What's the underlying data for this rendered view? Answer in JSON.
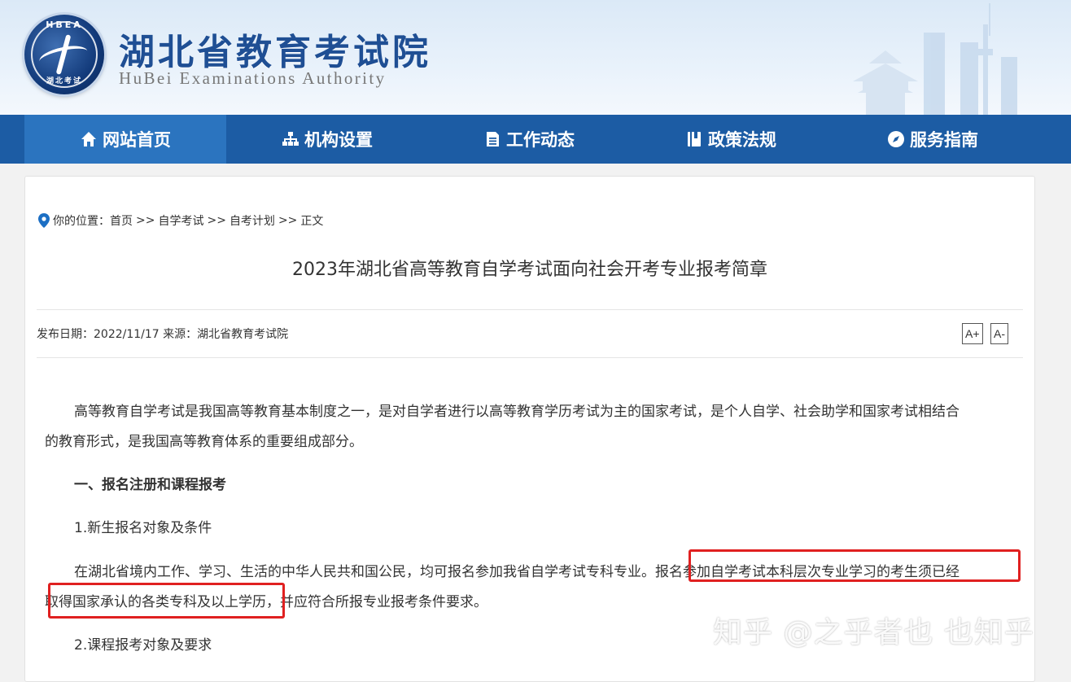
{
  "header": {
    "logo_top_text": "HBEA",
    "logo_bottom_text": "湖北考试",
    "title_cn": "湖北省教育考试院",
    "title_en": "HuBei Examinations Authority"
  },
  "nav": {
    "items": [
      {
        "label": "网站首页",
        "icon": "home-icon"
      },
      {
        "label": "机构设置",
        "icon": "org-chart-icon"
      },
      {
        "label": "工作动态",
        "icon": "document-icon"
      },
      {
        "label": "政策法规",
        "icon": "book-icon"
      },
      {
        "label": "服务指南",
        "icon": "compass-icon"
      }
    ],
    "active_index": 0
  },
  "breadcrumb": {
    "prefix": "你的位置：",
    "items": [
      "首页",
      "自学考试",
      "自考计划",
      "正文"
    ],
    "separator": ">>"
  },
  "article": {
    "title": "2023年湖北省高等教育自学考试面向社会开考专业报考简章",
    "meta": "发布日期：2022/11/17 来源：湖北省教育考试院",
    "font_increase": "A+",
    "font_decrease": "A-",
    "para1_line1": "高等教育自学考试是我国高等教育基本制度之一，是对自学者进行以高等教育学历考试为主的国家考试，是个人自学、社会助学和国家考试相结合",
    "para1_line2": "的教育形式，是我国高等教育体系的重要组成部分。",
    "section1": "一、报名注册和课程报考",
    "sub1": "1.新生报名对象及条件",
    "para2_line1": "在湖北省境内工作、学习、生活的中华人民共和国公民，均可报名参加我省自学考试专科专业。报名参加自学考试本科层次专业学习的考生须已经",
    "para2_line2": "取得国家承认的各类专科及以上学历，并应符合所报专业报考条件要求。",
    "sub2": "2.课程报考对象及要求"
  },
  "watermark": "知乎 @之乎者也 也知乎",
  "colors": {
    "nav_bg": "#1c5ca4",
    "nav_active": "#2b74bf",
    "title_blue": "#1f4f94",
    "highlight_red": "#e02020"
  }
}
